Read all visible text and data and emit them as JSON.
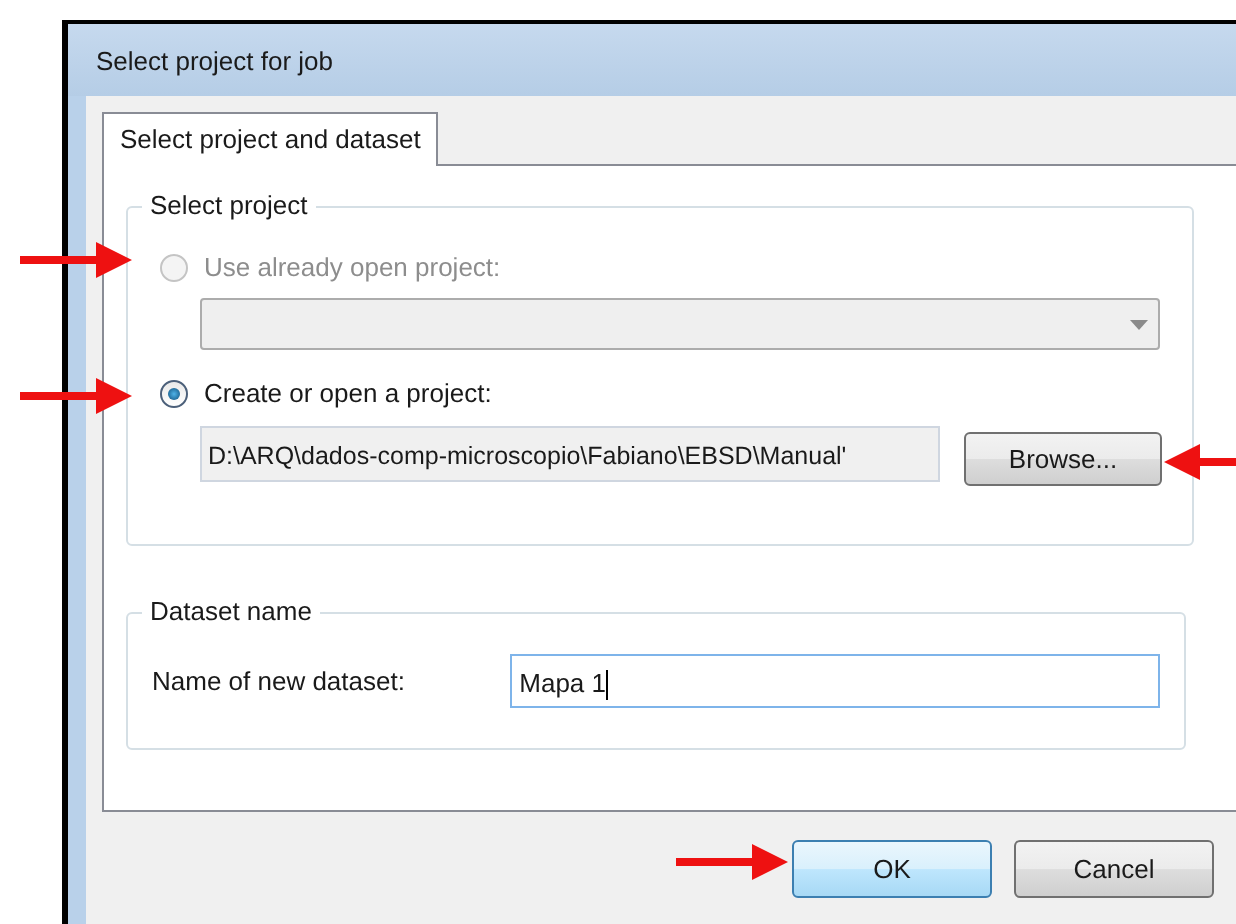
{
  "window": {
    "title": "Select project for job"
  },
  "tabs": [
    {
      "label": "Select project and dataset",
      "selected": true
    }
  ],
  "select_project": {
    "title": "Select project",
    "options": [
      {
        "label": "Use already open project:",
        "selected": false,
        "disabled": true,
        "kind": "dropdown"
      },
      {
        "label": "Create or open a project:",
        "selected": true,
        "disabled": false,
        "kind": "path",
        "value": "D:\\ARQ\\dados-comp-microscopio\\Fabiano\\EBSD\\Manual'",
        "button": "Browse..."
      }
    ]
  },
  "dataset": {
    "title": "Dataset name",
    "label": "Name of new dataset:",
    "value": "Mapa 1"
  },
  "buttons": [
    {
      "label": "OK",
      "default": true
    },
    {
      "label": "Cancel",
      "default": false
    }
  ],
  "annotations": [
    {
      "kind": "arrow",
      "points_left": false
    },
    {
      "kind": "arrow",
      "points_left": false
    },
    {
      "kind": "arrow",
      "points_left": true
    },
    {
      "kind": "arrow",
      "points_left": false
    }
  ]
}
